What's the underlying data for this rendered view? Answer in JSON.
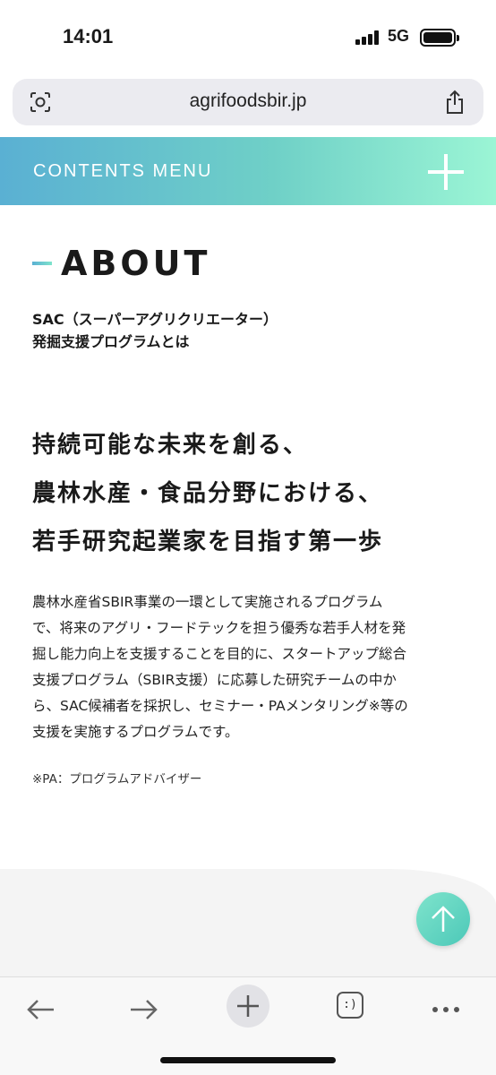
{
  "status": {
    "time": "14:01",
    "network": "5G"
  },
  "browser": {
    "url": "agrifoodsbir.jp",
    "tab_count": ":)"
  },
  "menu": {
    "label": "CONTENTS MENU"
  },
  "about": {
    "title": "ABOUT",
    "subtitle_line1": "SAC（スーパーアグリクリエーター）",
    "subtitle_line2": "発掘支援プログラムとは",
    "headline_line1": "持続可能な未来を創る、",
    "headline_line2": "農林水産・食品分野における、",
    "headline_line3": "若手研究起業家を目指す第一歩",
    "body_line1": "農林水産省SBIR事業の一環として実施されるプログラム",
    "body_line2": "で、将来のアグリ・フードテックを担う優秀な若手人材を発",
    "body_line3": "掘し能力向上を支援することを目的に、スタートアップ総合",
    "body_line4": "支援プログラム（SBIR支援）に応募した研究チームの中か",
    "body_line5": "ら、SAC候補者を採択し、セミナー・PAメンタリング※等の",
    "body_line6": "支援を実施するプログラムです。",
    "footnote": "※PA：プログラムアドバイザー"
  },
  "colors": {
    "gradient_start": "#5ab0d3",
    "gradient_end": "#9bf5d5",
    "accent": "#4cc8b8"
  }
}
